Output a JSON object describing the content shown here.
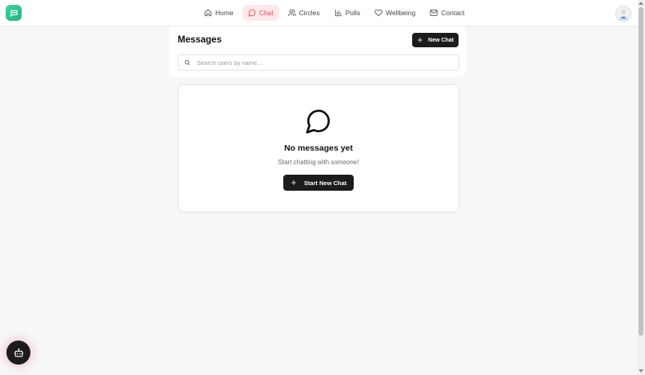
{
  "nav": {
    "items": [
      {
        "label": "Home",
        "icon": "home-icon",
        "active": false
      },
      {
        "label": "Chat",
        "icon": "chat-icon",
        "active": true
      },
      {
        "label": "Circles",
        "icon": "users-icon",
        "active": false
      },
      {
        "label": "Polls",
        "icon": "bar-chart-icon",
        "active": false
      },
      {
        "label": "Wellbeing",
        "icon": "heart-icon",
        "active": false
      },
      {
        "label": "Contact",
        "icon": "mail-icon",
        "active": false
      }
    ]
  },
  "colors": {
    "accent": "#e5485c",
    "accent_bg": "#fde8ea",
    "brand": "#1fb386",
    "dark_button": "#1c1c1e"
  },
  "messages": {
    "title": "Messages",
    "new_chat_label": "New Chat",
    "search_placeholder": "Search users by name..."
  },
  "empty_state": {
    "title": "No messages yet",
    "subtitle": "Start chatting with someone!",
    "button_label": "Start New Chat"
  }
}
